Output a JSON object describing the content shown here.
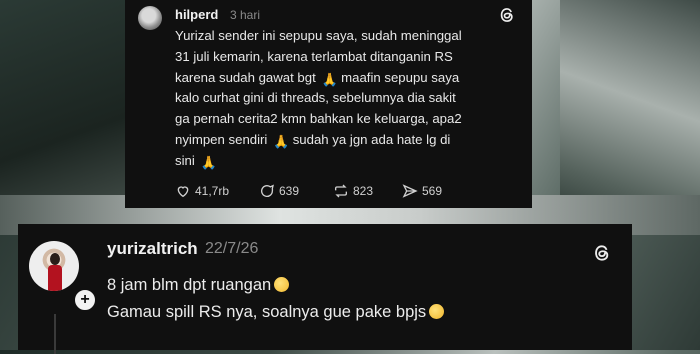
{
  "post": {
    "author": "hilperd",
    "time": "3 hari",
    "text_lines": [
      "Yurizal sender ini sepupu saya, sudah meninggal",
      "31 juli kemarin, karena terlambat ditanganin RS",
      "karena sudah gawat bgt",
      "maafin sepupu saya",
      "kalo curhat gini di threads, sebelumnya dia sakit",
      "ga pernah cerita2 kmn bahkan ke keluarga, apa2",
      "nyimpen sendiri",
      "sudah ya jgn ada hate lg di",
      "sini"
    ],
    "actions": {
      "likes": "41,7rb",
      "comments": "639",
      "reposts": "823",
      "shares": "569"
    }
  },
  "reply": {
    "author": "yurizaltrich",
    "time": "22/7/26",
    "lines": [
      "8 jam blm dpt ruangan",
      "Gamau spill RS nya, soalnya gue pake bpjs"
    ]
  },
  "icons": {
    "threads": "threads-logo-icon",
    "like": "heart-icon",
    "comment": "comment-icon",
    "repost": "repost-icon",
    "share": "share-icon",
    "follow": "plus-icon",
    "emoji_pray": "folded-hands-emoji",
    "emoji_sad": "frowning-face-emoji",
    "emoji_plead": "pleading-face-emoji"
  },
  "colors": {
    "card_bg": "#101010",
    "text": "#e6e6e6",
    "muted": "#8a8a8a"
  }
}
